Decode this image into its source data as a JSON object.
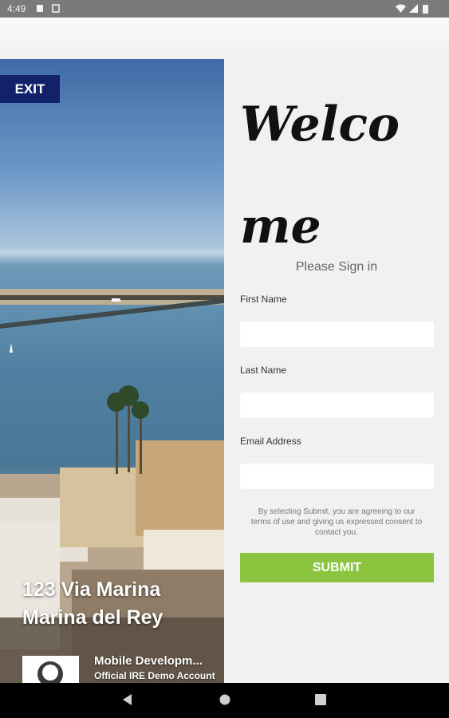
{
  "status_bar": {
    "time": "4:49"
  },
  "hero": {
    "exit_label": "EXIT",
    "address_line1": "123 Via Marina",
    "address_line2": "Marina del Rey",
    "agent_name": "Mobile Developm...",
    "agent_subtitle": "Official IRE Demo Account"
  },
  "form": {
    "welcome_line1": "Welco",
    "welcome_line2": "me",
    "subtitle": "Please Sign in",
    "first_name_label": "First Name",
    "last_name_label": "Last Name",
    "email_label": "Email Address",
    "first_name_value": "",
    "last_name_value": "",
    "email_value": "",
    "disclaimer": "By selecting Submit, you are agreeing to our terms of use and giving us expressed consent to contact you.",
    "submit_label": "SUBMIT"
  },
  "colors": {
    "exit_bg": "#11226a",
    "submit_bg": "#8bc43f",
    "panel_bg": "#f1f1f1"
  }
}
